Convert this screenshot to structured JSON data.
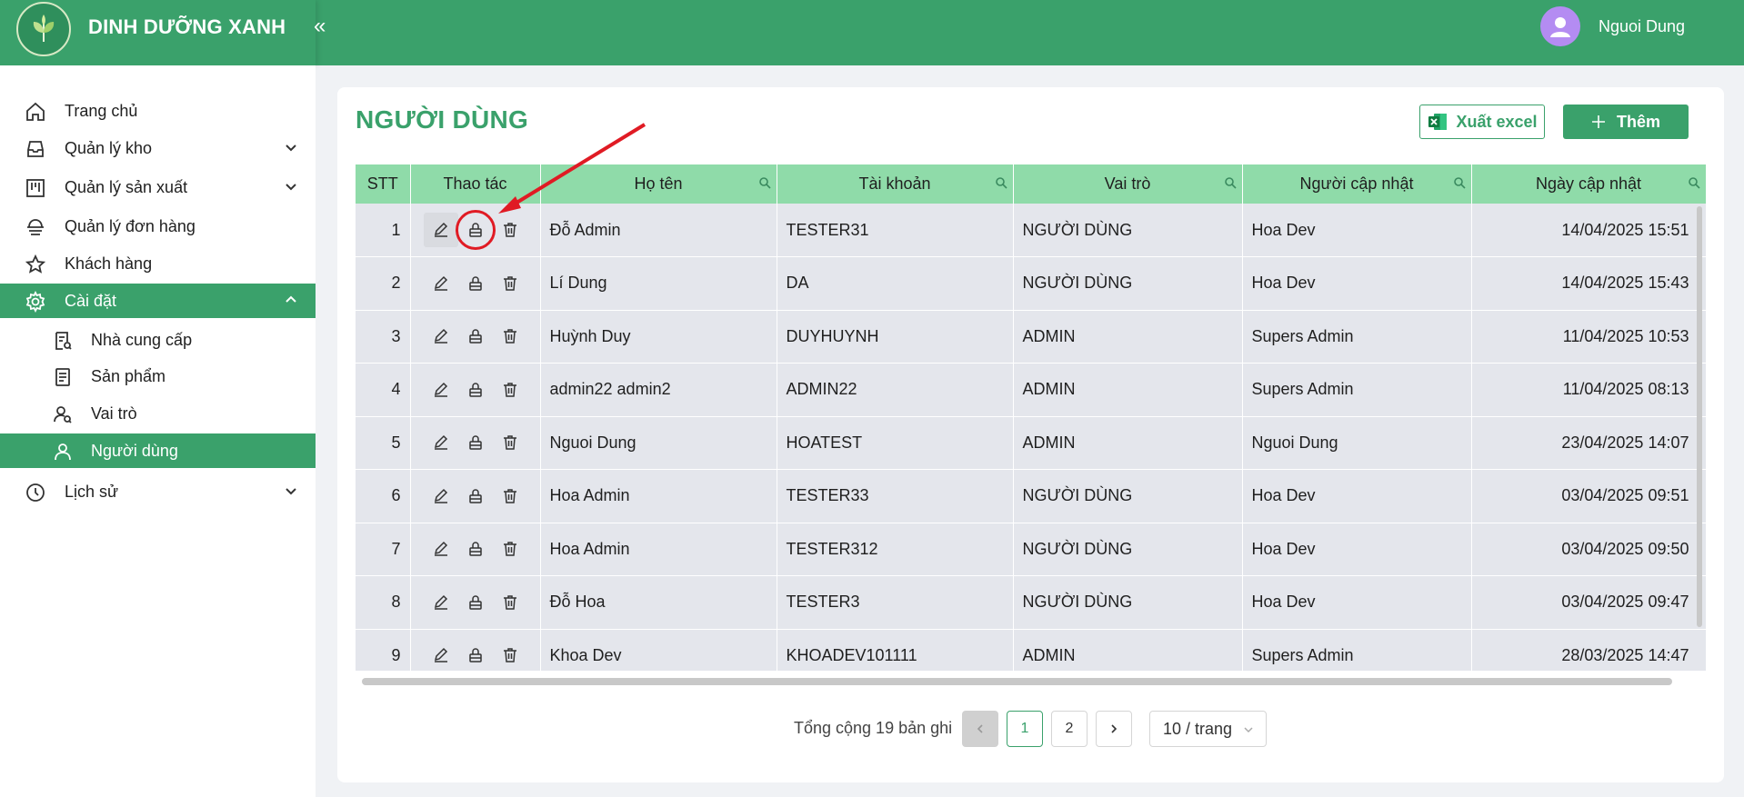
{
  "app": {
    "brand_name": "DINH DƯỠNG XANH",
    "collapse_icon": "«",
    "user_name": "Nguoi Dung"
  },
  "sidebar": {
    "items": [
      {
        "label": "Trang chủ",
        "icon": "home-icon"
      },
      {
        "label": "Quản lý kho",
        "icon": "inbox-icon"
      },
      {
        "label": "Quản lý sản xuất",
        "icon": "factory-icon"
      },
      {
        "label": "Quản lý đơn hàng",
        "icon": "order-icon"
      },
      {
        "label": "Khách hàng",
        "icon": "star-icon"
      },
      {
        "label": "Cài đặt",
        "icon": "gear-icon"
      },
      {
        "label": "Nhà cung cấp",
        "icon": "supplier-icon"
      },
      {
        "label": "Sản phẩm",
        "icon": "product-icon"
      },
      {
        "label": "Vai trò",
        "icon": "roles-icon"
      },
      {
        "label": "Người dùng",
        "icon": "user-icon"
      },
      {
        "label": "Lịch sử",
        "icon": "history-icon"
      }
    ],
    "active_parent": "Cài đặt",
    "active_item": "Người dùng"
  },
  "page": {
    "title": "NGƯỜI DÙNG",
    "export_label": "Xuất excel",
    "add_label": "Thêm",
    "accent": "#3aa16b"
  },
  "table": {
    "headers": [
      "STT",
      "Thao tác",
      "Họ tên",
      "Tài khoản",
      "Vai trò",
      "Người cập nhật",
      "Ngày cập nhật"
    ],
    "rows": [
      {
        "stt": "1",
        "name": "Đỗ Admin",
        "account": "TESTER31",
        "role": "NGƯỜI DÙNG",
        "updated_by": "Hoa Dev",
        "updated_at": "14/04/2025 15:51"
      },
      {
        "stt": "2",
        "name": "Lí Dung",
        "account": "DA",
        "role": "NGƯỜI DÙNG",
        "updated_by": "Hoa Dev",
        "updated_at": "14/04/2025 15:43"
      },
      {
        "stt": "3",
        "name": "Huỳnh Duy",
        "account": "DUYHUYNH",
        "role": "ADMIN",
        "updated_by": "Supers Admin",
        "updated_at": "11/04/2025 10:53"
      },
      {
        "stt": "4",
        "name": "admin22 admin2",
        "account": "ADMIN22",
        "role": "ADMIN",
        "updated_by": "Supers Admin",
        "updated_at": "11/04/2025 08:13"
      },
      {
        "stt": "5",
        "name": "Nguoi Dung",
        "account": "HOATEST",
        "role": "ADMIN",
        "updated_by": "Nguoi Dung",
        "updated_at": "23/04/2025 14:07"
      },
      {
        "stt": "6",
        "name": "Hoa Admin",
        "account": "TESTER33",
        "role": "NGƯỜI DÙNG",
        "updated_by": "Hoa Dev",
        "updated_at": "03/04/2025 09:51"
      },
      {
        "stt": "7",
        "name": "Hoa Admin",
        "account": "TESTER312",
        "role": "NGƯỜI DÙNG",
        "updated_by": "Hoa Dev",
        "updated_at": "03/04/2025 09:50"
      },
      {
        "stt": "8",
        "name": "Đỗ Hoa",
        "account": "TESTER3",
        "role": "NGƯỜI DÙNG",
        "updated_by": "Hoa Dev",
        "updated_at": "03/04/2025 09:47"
      },
      {
        "stt": "9",
        "name": "Khoa Dev",
        "account": "KHOADEV101111",
        "role": "ADMIN",
        "updated_by": "Supers Admin",
        "updated_at": "28/03/2025 14:47"
      }
    ],
    "row_actions": [
      "edit-icon",
      "lock-icon",
      "trash-icon"
    ]
  },
  "pagination": {
    "total_text": "Tổng cộng 19 bản ghi",
    "pages": [
      "1",
      "2"
    ],
    "current_page": "1",
    "page_size": "10 / trang"
  },
  "annotation": {
    "color": "#e01b24",
    "target": "lock-icon row 1"
  }
}
